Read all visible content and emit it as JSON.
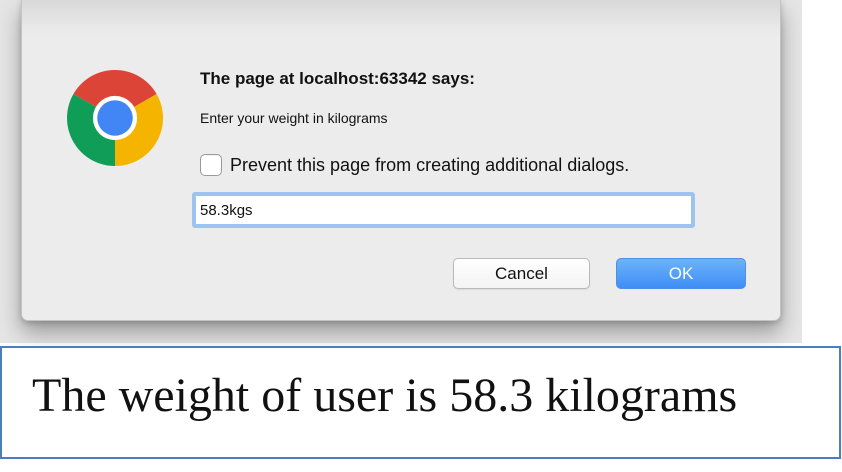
{
  "dialog": {
    "title": "The page at localhost:63342 says:",
    "message": "Enter your weight in kilograms",
    "prevent_checkbox": {
      "label": "Prevent this page from creating additional dialogs.",
      "checked": false
    },
    "input": {
      "value": "58.3kgs"
    },
    "buttons": {
      "cancel_label": "Cancel",
      "ok_label": "OK"
    },
    "icon": "chrome-logo-icon"
  },
  "result": {
    "text": "The weight of user is 58.3 kilograms"
  },
  "colors": {
    "ok_button": "#4a95f6",
    "input_focus_ring": "#9cc3f2",
    "result_border": "#4a7fbd",
    "dialog_background": "#ececec"
  }
}
